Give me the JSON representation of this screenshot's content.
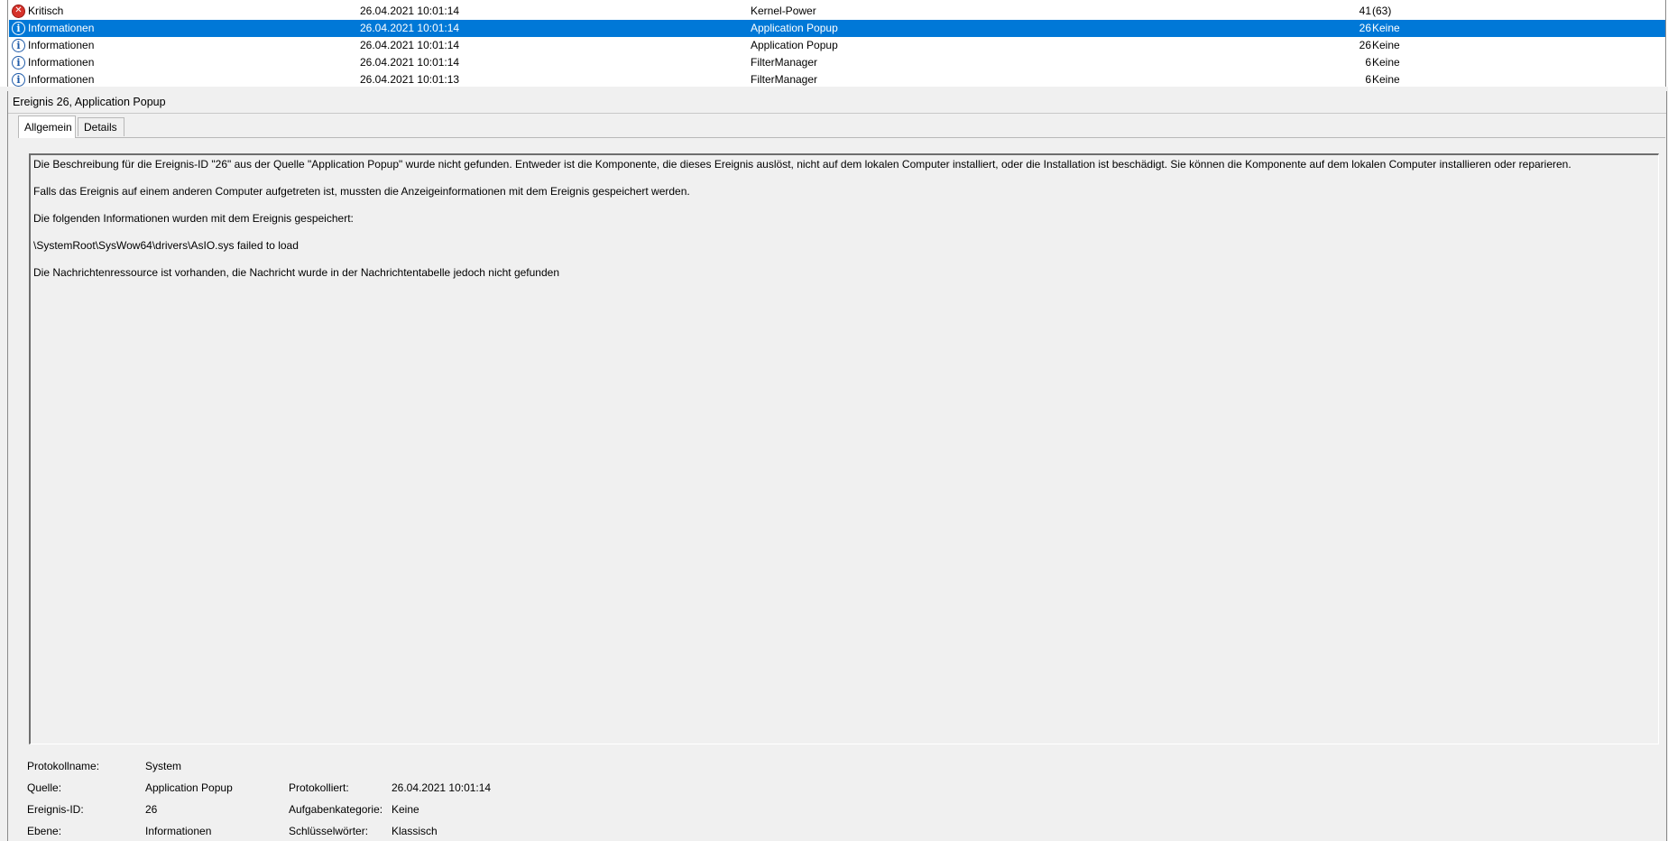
{
  "event_list": {
    "rows": [
      {
        "level": "Kritisch",
        "icon": "critical-icon",
        "date": "26.04.2021 10:01:14",
        "source": "Kernel-Power",
        "event_id": "41",
        "task": "(63)",
        "selected": false
      },
      {
        "level": "Informationen",
        "icon": "info-icon",
        "date": "26.04.2021 10:01:14",
        "source": "Application Popup",
        "event_id": "26",
        "task": "Keine",
        "selected": true
      },
      {
        "level": "Informationen",
        "icon": "info-icon",
        "date": "26.04.2021 10:01:14",
        "source": "Application Popup",
        "event_id": "26",
        "task": "Keine",
        "selected": false
      },
      {
        "level": "Informationen",
        "icon": "info-icon",
        "date": "26.04.2021 10:01:14",
        "source": "FilterManager",
        "event_id": "6",
        "task": "Keine",
        "selected": false
      },
      {
        "level": "Informationen",
        "icon": "info-icon",
        "date": "26.04.2021 10:01:13",
        "source": "FilterManager",
        "event_id": "6",
        "task": "Keine",
        "selected": false
      }
    ],
    "selection_color": "#0078d7"
  },
  "detail": {
    "title": "Ereignis 26, Application Popup",
    "tabs": [
      "Allgemein",
      "Details"
    ],
    "active_tab": "Allgemein",
    "description": [
      "Die Beschreibung für die Ereignis-ID \"26\" aus der Quelle \"Application Popup\" wurde nicht gefunden. Entweder ist die Komponente, die dieses Ereignis auslöst, nicht auf dem lokalen Computer installiert, oder die Installation ist beschädigt. Sie können die Komponente auf dem lokalen Computer installieren oder reparieren.",
      "Falls das Ereignis auf einem anderen Computer aufgetreten ist, mussten die Anzeigeinformationen mit dem Ereignis gespeichert werden.",
      "Die folgenden Informationen wurden mit dem Ereignis gespeichert:",
      "\\SystemRoot\\SysWow64\\drivers\\AsIO.sys failed to load",
      "Die Nachrichtenressource ist vorhanden, die Nachricht wurde in der Nachrichtentabelle jedoch nicht gefunden"
    ],
    "properties": {
      "log_name": {
        "label": "Protokollname:",
        "value": "System"
      },
      "source": {
        "label": "Quelle:",
        "value": "Application Popup"
      },
      "logged": {
        "label": "Protokolliert:",
        "value": "26.04.2021 10:01:14"
      },
      "event_id": {
        "label": "Ereignis-ID:",
        "value": "26"
      },
      "task_category": {
        "label": "Aufgabenkategorie:",
        "value": "Keine"
      },
      "level": {
        "label": "Ebene:",
        "value": "Informationen"
      },
      "keywords": {
        "label": "Schlüsselwörter:",
        "value": "Klassisch"
      }
    }
  }
}
